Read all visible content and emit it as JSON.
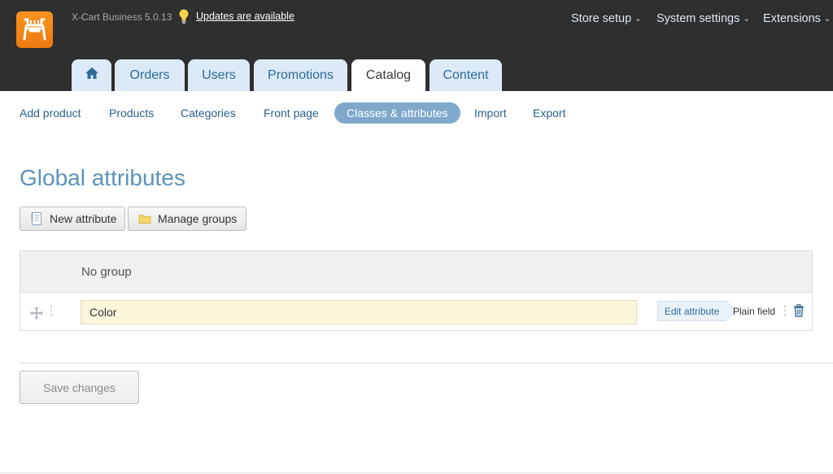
{
  "header": {
    "version": "X-Cart Business 5.0.13",
    "updates_link": "Updates are available",
    "menu": [
      "Store setup",
      "System settings",
      "Extensions"
    ],
    "tabs": [
      "Orders",
      "Users",
      "Promotions",
      "Catalog",
      "Content"
    ],
    "active_tab": "Catalog"
  },
  "subnav": {
    "items": [
      "Add product",
      "Products",
      "Categories",
      "Front page",
      "Classes & attributes",
      "Import",
      "Export"
    ],
    "active": "Classes & attributes"
  },
  "page": {
    "title": "Global attributes",
    "new_attribute": "New attribute",
    "manage_groups": "Manage groups"
  },
  "table": {
    "group": "No group",
    "rows": [
      {
        "name": "Color",
        "edit_label": "Edit attribute",
        "type": "Plain field"
      }
    ]
  },
  "footer": {
    "save": "Save changes"
  },
  "colors": {
    "header_bg": "#2f2f2f",
    "tab_bg": "#dbeaf6",
    "accent": "#5b93bd",
    "pill": "#7fa8cb",
    "logo": "#f7931e"
  }
}
